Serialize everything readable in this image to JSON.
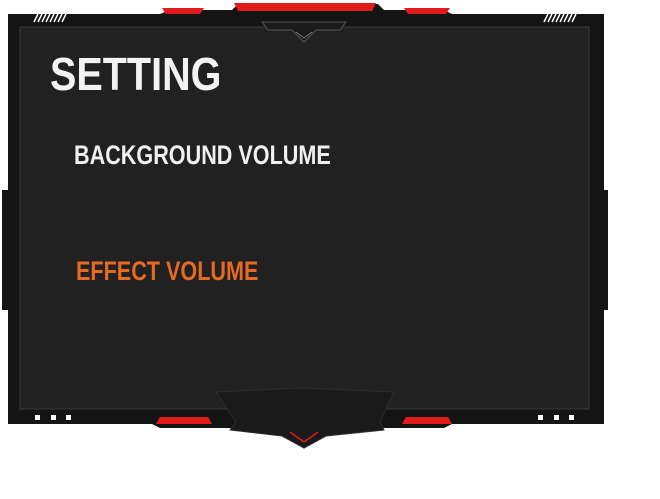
{
  "panel": {
    "title": "SETTING",
    "options": [
      {
        "label": "BACKGROUND VOLUME",
        "state": "normal"
      },
      {
        "label": "EFFECT VOLUME",
        "state": "selected"
      }
    ]
  },
  "colors": {
    "panel_bg": "#212121",
    "frame": "#141414",
    "accent_red": "#e11b1b",
    "highlight_orange": "#e66a22",
    "text_light": "#f3f3f6"
  }
}
